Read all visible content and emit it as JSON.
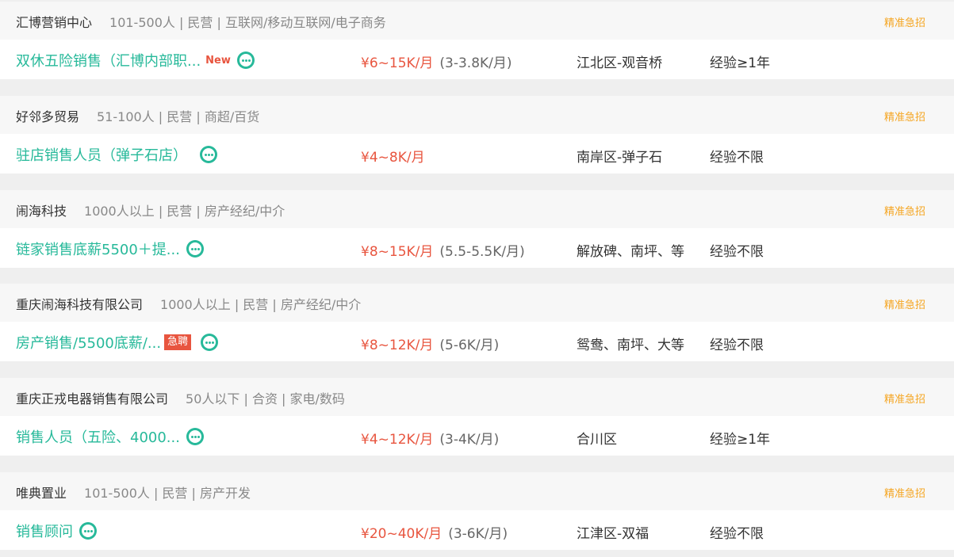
{
  "urgent_label": "精准急招",
  "jobs": [
    {
      "company": "汇博营销中心",
      "meta": "101-500人 | 民营 | 互联网/移动互联网/电子商务",
      "title": "双休五险销售（汇博内部职...",
      "badge_new": "New",
      "badge_hot": "",
      "salary": "¥6~15K/月",
      "salary_monthly": "(3-3.8K/月)",
      "location": "江北区-观音桥",
      "experience": "经验≥1年"
    },
    {
      "company": "好邻多贸易",
      "meta": "51-100人 | 民营 | 商超/百货",
      "title": "驻店销售人员（弹子石店）",
      "badge_new": "",
      "badge_hot": "",
      "salary": "¥4~8K/月",
      "salary_monthly": "",
      "location": "南岸区-弹子石",
      "experience": "经验不限"
    },
    {
      "company": "闹海科技",
      "meta": "1000人以上 | 民营 | 房产经纪/中介",
      "title": "链家销售底薪5500＋提...",
      "badge_new": "",
      "badge_hot": "",
      "salary": "¥8~15K/月",
      "salary_monthly": "(5.5-5.5K/月)",
      "location": "解放碑、南坪、等",
      "experience": "经验不限"
    },
    {
      "company": "重庆闹海科技有限公司",
      "meta": "1000人以上 | 民营 | 房产经纪/中介",
      "title": "房产销售/5500底薪/...",
      "badge_new": "",
      "badge_hot": "急聘",
      "salary": "¥8~12K/月",
      "salary_monthly": "(5-6K/月)",
      "location": "鸳鸯、南坪、大等",
      "experience": "经验不限"
    },
    {
      "company": "重庆正戎电器销售有限公司",
      "meta": "50人以下 | 合资 | 家电/数码",
      "title": "销售人员（五险、4000...",
      "badge_new": "",
      "badge_hot": "",
      "salary": "¥4~12K/月",
      "salary_monthly": "(3-4K/月)",
      "location": "合川区",
      "experience": "经验≥1年"
    },
    {
      "company": "唯典置业",
      "meta": "101-500人 | 民营 | 房产开发",
      "title": "销售顾问",
      "badge_new": "",
      "badge_hot": "",
      "salary": "¥20~40K/月",
      "salary_monthly": "(3-6K/月)",
      "location": "江津区-双福",
      "experience": "经验不限"
    }
  ]
}
